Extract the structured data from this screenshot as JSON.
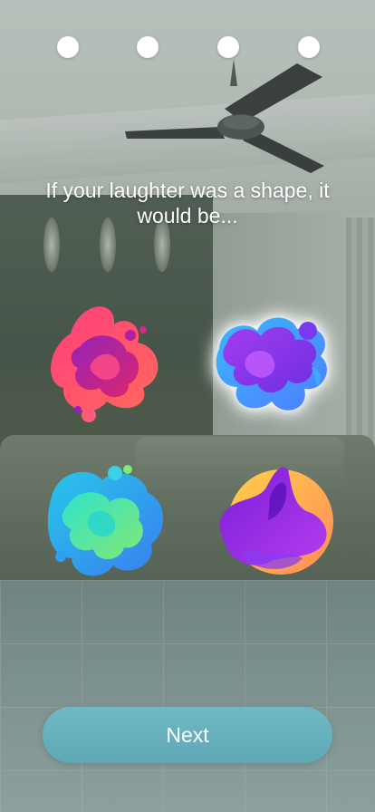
{
  "progress": {
    "total_steps": 4,
    "current_step": 4
  },
  "question": "If your laughter was a shape, it would be...",
  "options": [
    {
      "name": "pink-purple-blob",
      "selected": false
    },
    {
      "name": "purple-blue-blob",
      "selected": true
    },
    {
      "name": "cyan-green-blob",
      "selected": false
    },
    {
      "name": "orange-purple-blob",
      "selected": false
    }
  ],
  "next_label": "Next",
  "colors": {
    "button": "#64aebb",
    "text": "#ffffff"
  }
}
